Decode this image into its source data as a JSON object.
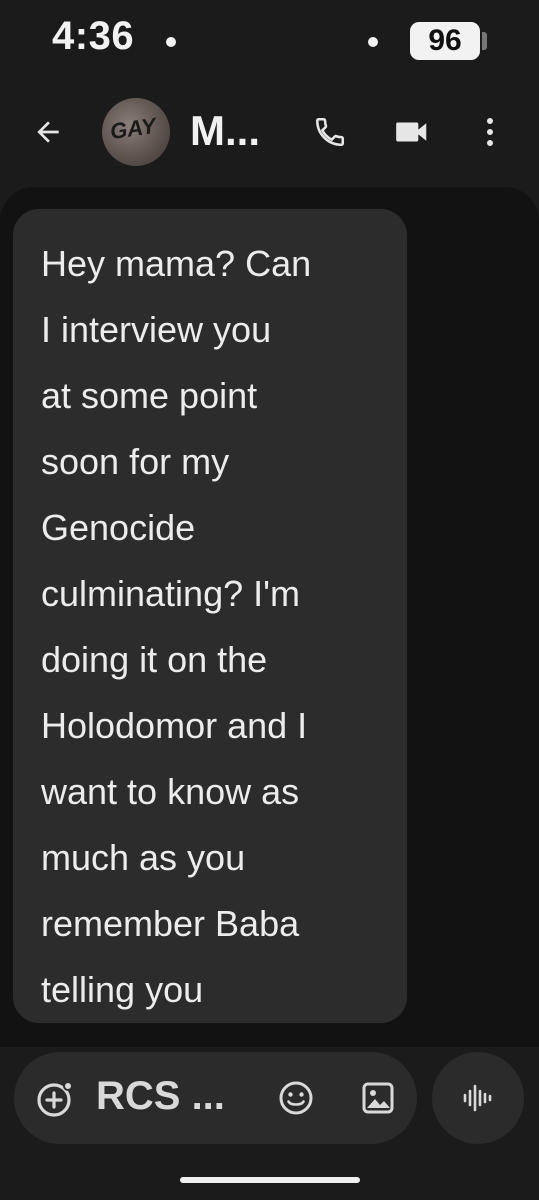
{
  "status_bar": {
    "time": "4:36",
    "battery": "96"
  },
  "header": {
    "contact_name": "M...",
    "avatar_text": "GAY"
  },
  "icons": {
    "back": "arrow-back-icon",
    "call": "phone-icon",
    "video": "video-camera-icon",
    "more": "more-vert-icon",
    "add": "add-circle-icon",
    "emoji": "emoji-icon",
    "gallery": "image-icon",
    "voice": "voice-wave-icon"
  },
  "message": {
    "text": "Hey mama? Can\nI interview you\nat some point\nsoon for my\nGenocide\nculminating? I'm\ndoing it on the\nHolodomor and I\nwant to know as\nmuch as you\nremember Baba\ntelling you"
  },
  "compose": {
    "placeholder": "RCS ..."
  },
  "colors": {
    "background": "#1b1b1b",
    "chat_panel": "#121212",
    "bubble": "#2c2c2c",
    "text": "#ececec"
  }
}
